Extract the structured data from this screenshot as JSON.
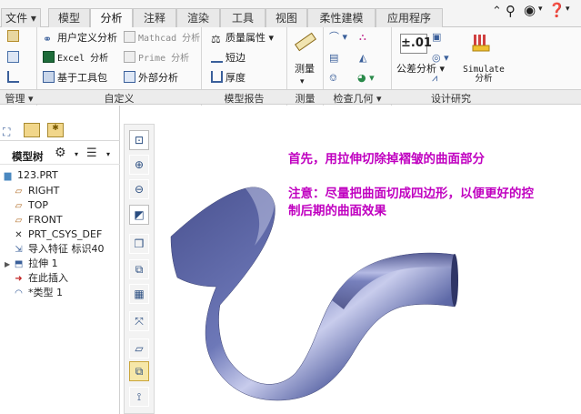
{
  "tabs": [
    "文件",
    "模型",
    "分析",
    "注释",
    "渲染",
    "工具",
    "视图",
    "柔性建模",
    "应用程序"
  ],
  "active_tab": "分析",
  "ribbon": {
    "custom": {
      "user_analysis": "用户定义分析",
      "mathcad": "Mathcad 分析",
      "excel": "Excel 分析",
      "prime": "Prime 分析",
      "toolkit": "基于工具包",
      "external": "外部分析"
    },
    "report": {
      "mass_props": "质量属性",
      "short_edge": "短边",
      "thickness": "厚度"
    },
    "measure_label": "测量",
    "tolerance_label": "公差分析",
    "tolerance_value": "±.01",
    "simulate_label": "Simulate 分析",
    "groups": [
      "管理",
      "自定义",
      "模型报告",
      "测量",
      "检查几何",
      "设计研究"
    ]
  },
  "model_tree": {
    "title": "模型树",
    "items": [
      "123.PRT",
      "RIGHT",
      "TOP",
      "FRONT",
      "PRT_CSYS_DEF",
      "导入特征 标识40",
      "拉伸 1",
      "在此插入",
      "*类型 1"
    ]
  },
  "annotations": {
    "line1": "首先，用拉伸切除掉褶皱的曲面部分",
    "line2": "注意：尽量把曲面切成四边形，以便更好的控",
    "line3": "制后期的曲面效果"
  },
  "colors": {
    "annotation": "#c000c0",
    "surface": "#5e6aa8"
  }
}
